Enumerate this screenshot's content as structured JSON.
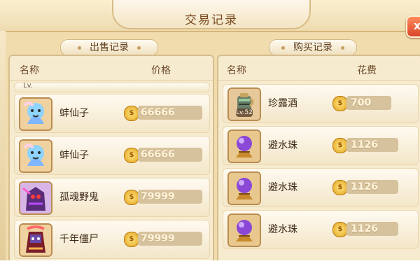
{
  "title": "交易记录",
  "close_label": "x",
  "sell": {
    "pill": "出售记录",
    "col_name": "名称",
    "col_price": "价格",
    "partial_level": "Lv.",
    "items": [
      {
        "name": "蚌仙子",
        "price": "66666",
        "icon": "mermaid-fairy-icon"
      },
      {
        "name": "蚌仙子",
        "price": "66666",
        "icon": "mermaid-fairy-icon"
      },
      {
        "name": "孤魂野鬼",
        "price": "79999",
        "icon": "ghost-warrior-icon"
      },
      {
        "name": "千年僵尸",
        "price": "79999",
        "icon": "zombie-warrior-icon"
      }
    ]
  },
  "buy": {
    "pill": "购买记录",
    "col_name": "名称",
    "col_cost": "花费",
    "items": [
      {
        "name": "珍露酒",
        "price": "700",
        "icon": "wine-jug-icon",
        "level": "Lv.52"
      },
      {
        "name": "避水珠",
        "price": "1126",
        "icon": "purple-orb-icon"
      },
      {
        "name": "避水珠",
        "price": "1126",
        "icon": "purple-orb-icon"
      },
      {
        "name": "避水珠",
        "price": "1126",
        "icon": "purple-orb-icon"
      }
    ]
  },
  "colors": {
    "panel_bg": "#f7ebcf",
    "row_bg": "#fffaf1",
    "price_bar": "#d6c29d",
    "coin": "#f1bf2d",
    "close_button": "#e05a38"
  }
}
